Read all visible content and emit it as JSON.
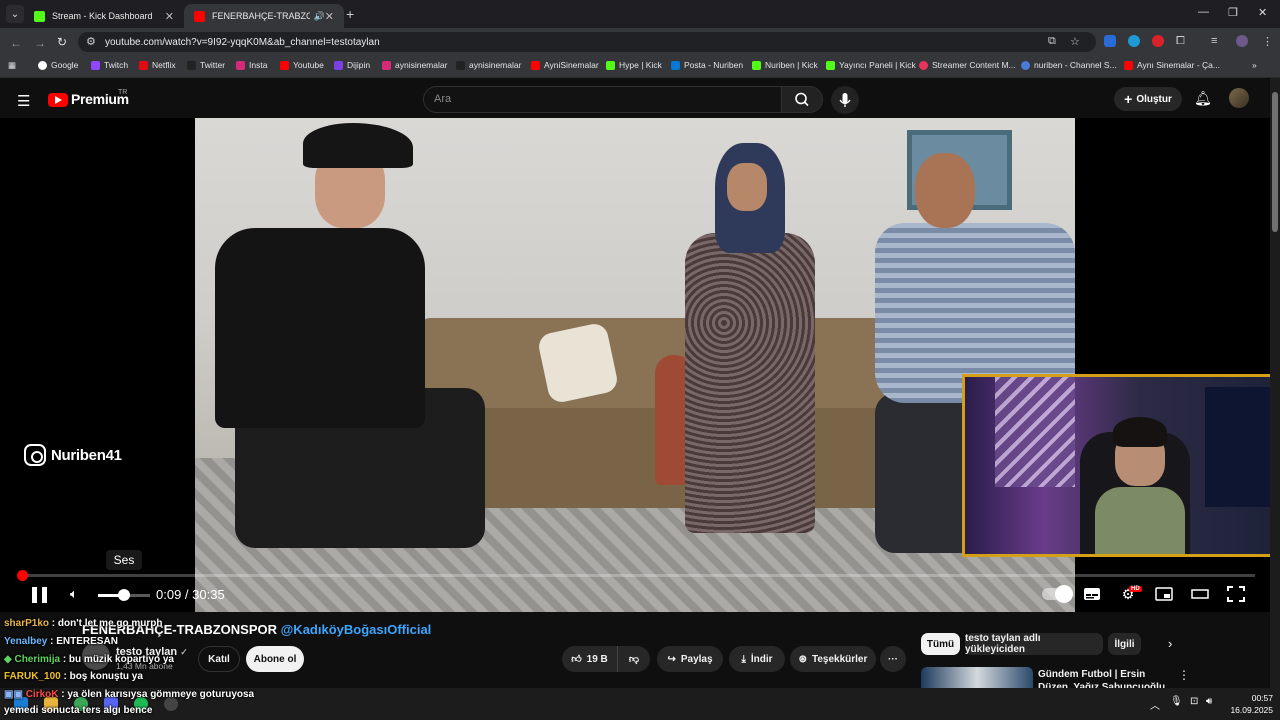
{
  "browser": {
    "tabs": [
      {
        "title": "Stream - Kick Dashboard",
        "active": false
      },
      {
        "title": "FENERBAHÇE-TRABZONSPO",
        "active": true
      }
    ],
    "url": "youtube.com/watch?v=9I92-yqqK0M&ab_channel=testotaylan",
    "bookmarks": [
      "Google",
      "Twitch",
      "Netflix",
      "Twitter",
      "Insta",
      "Youtube",
      "Dijipin",
      "aynisinemalar",
      "aynisinemalar",
      "AyniSinemalar",
      "Hype | Kick",
      "Posta - Nuriben",
      "Nuriben | Kick",
      "Yayıncı Paneli | Kick",
      "Streamer Content M...",
      "nuriben - Channel S...",
      "Aynı Sinemalar - Ça..."
    ]
  },
  "youtube": {
    "logo": "Premium",
    "region": "TR",
    "search_placeholder": "Ara",
    "create_label": "Oluştur"
  },
  "player": {
    "watermark": "Nuriben41",
    "tooltip": "Ses",
    "time": "0:09 / 30:35",
    "progress_fraction": 0.005,
    "volume_fraction": 0.48
  },
  "video": {
    "title": "FENERBAHÇE-TRABZONSPOR ",
    "title_tag": "@KadıköyBoğasıOfficial",
    "channel": "testo taylan",
    "subscribers": "1,43 Mn abone",
    "join_label": "Katıl",
    "subscribe_label": "Abone ol",
    "likes": "19 B",
    "share_label": "Paylaş",
    "download_label": "İndir",
    "thanks_label": "Teşekkürler"
  },
  "sidebar": {
    "chips": [
      "Tümü",
      "testo taylan adlı yükleyiciden",
      "İlgili"
    ],
    "rec_title": "Gündem Futbol | Ersin Düzen, Yağız Sabuncuoğlu, Uğur"
  },
  "chat": [
    {
      "user": "sharP1ko",
      "msg": " : don't let me go murph",
      "color": "#e8b44a"
    },
    {
      "user": "Yenalbey",
      "msg": " : ENTERESAN",
      "color": "#6bb8ff"
    },
    {
      "user": "Cherimija",
      "msg": " : bu müzik kopartiyo ya",
      "color": "#5fd35f"
    },
    {
      "user": "FARUK_100",
      "msg": " : boş konuştu ya",
      "color": "#f0c02a"
    },
    {
      "user": "CirkoK",
      "msg": " : ya ölen karısıysa gömmeye goturuyosa",
      "color": "#ff4a4a"
    },
    {
      "user": "",
      "msg": "yemedi sonucta ters algı bence",
      "color": "#ffffff"
    }
  ],
  "taskbar": {
    "time": "00:57",
    "date": "16.09.2025"
  },
  "colors": {
    "accent_red": "#ff0000",
    "webcam_border": "#d4a017",
    "link_blue": "#3ea6ff"
  }
}
